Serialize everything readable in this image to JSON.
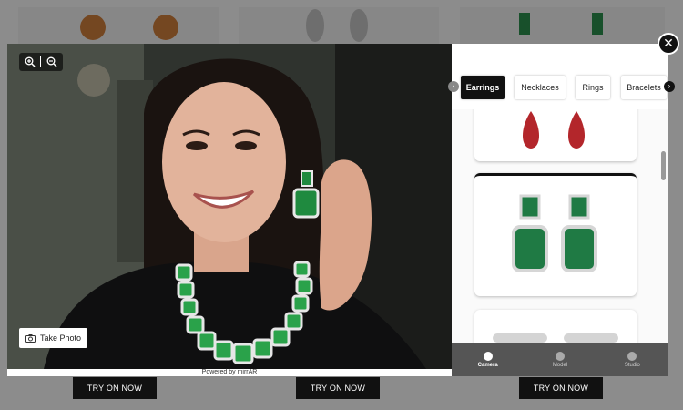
{
  "background": {
    "try_buttons": [
      "TRY ON NOW",
      "TRY ON NOW",
      "TRY ON NOW"
    ]
  },
  "modal": {
    "close_icon": "close-icon",
    "camera": {
      "zoom_in_icon": "zoom-in-icon",
      "zoom_out_icon": "zoom-out-icon",
      "take_photo_label": "Take Photo",
      "powered_by": "Powered by mirrAR"
    },
    "tabs": [
      "Earrings",
      "Necklaces",
      "Rings",
      "Bracelets"
    ],
    "active_tab": "Earrings",
    "products": [
      {
        "name": "ruby drop earrings",
        "color": "#b3262b"
      },
      {
        "name": "emerald cushion drop earrings",
        "color": "#1f7a44"
      },
      {
        "name": "diamond earrings",
        "color": "#c8c8c8"
      }
    ],
    "bottom_nav": [
      {
        "label": "Camera",
        "icon": "camera-icon",
        "active": true
      },
      {
        "label": "Model",
        "icon": "model-icon",
        "active": false
      },
      {
        "label": "Studio",
        "icon": "studio-icon",
        "active": false
      }
    ]
  },
  "colors": {
    "accent": "#111111",
    "emerald": "#1f8a3f"
  }
}
